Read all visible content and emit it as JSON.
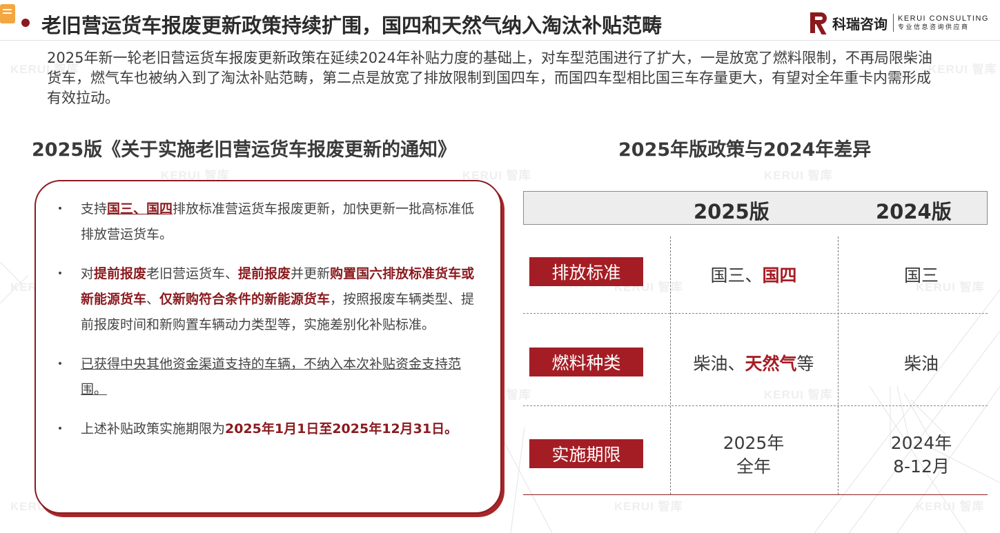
{
  "header": {
    "title": "老旧营运货车报废更新政策持续扩围，国四和天然气纳入淘汰补贴范畴",
    "brand_name": "科瑞咨询",
    "brand_en": "KERUI CONSULTING",
    "brand_tagline": "专业信息咨询供应商"
  },
  "intro": "2025年新一轮老旧营运货车报废更新政策在延续2024年补贴力度的基础上，对车型范围进行了扩大，一是放宽了燃料限制，不再局限柴油货车，燃气车也被纳入到了淘汰补贴范畴，第二点是放宽了排放限制到国四车，而国四车型相比国三车存量更大，有望对全年重卡内需形成有效拉动。",
  "left": {
    "heading": "2025版《关于实施老旧营运货车报废更新的通知》",
    "bullet_char": "•",
    "b1": {
      "t1": "支持",
      "t2": "国三、国四",
      "t3": "排放标准营运货车报废更新，加快更新一批高标准低排放营运货车。"
    },
    "b2": {
      "t1": "对",
      "t2": "提前报废",
      "t3": "老旧营运货车、",
      "t4": "提前报废",
      "t5": "并更新",
      "t6": "购置国六排放标准货车或新能源货车",
      "t7": "、",
      "t8": "仅新购符合条件的新能源货车",
      "t9": "，按照报废车辆类型、提前报废时间和新购置车辆动力类型等，实施差别化补贴标准。"
    },
    "b3": {
      "t1": "已获得中央其他资金渠道支持的车辆，不纳入本次补贴资金支持范围。"
    },
    "b4": {
      "t1": "上述补贴政策实施期限为",
      "t2": "2025年1月1日至2025年12月31日。"
    }
  },
  "right": {
    "heading": "2025年版政策与2024年差异",
    "col_2025": "2025版",
    "col_2024": "2024版",
    "rows": [
      {
        "label": "排放标准",
        "v2025_a": "国三、",
        "v2025_b": "国四",
        "v2024": "国三"
      },
      {
        "label": "燃料种类",
        "v2025_a": "柴油、",
        "v2025_b": "天然气",
        "v2025_c": "等",
        "v2024": "柴油"
      },
      {
        "label": "实施期限",
        "v2025_l1": "2025年",
        "v2025_l2": "全年",
        "v2024_l1": "2024年",
        "v2024_l2": "8-12月"
      }
    ]
  },
  "watermark": "KERUI 智库",
  "colors": {
    "accent": "#8b1a1e",
    "label_bg": "#a51d24",
    "header_bg": "#ededed"
  },
  "icons": [
    "chat-icon",
    "kerui-logo"
  ]
}
